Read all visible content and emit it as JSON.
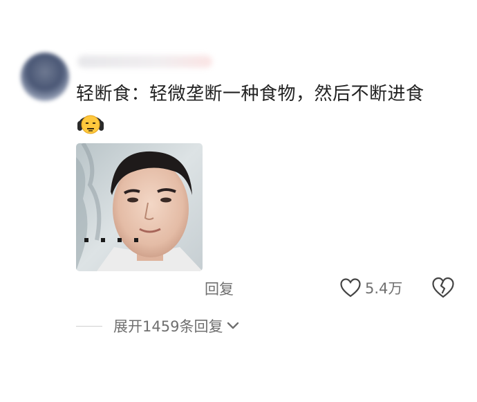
{
  "comment": {
    "username": "",
    "text": "轻断食：轻微垄断一种食物，然后不断进食",
    "emoji": "headphones-face-emoji",
    "image": "portrait-photo"
  },
  "actions": {
    "reply_label": "回复",
    "like_count": "5.4万",
    "like_icon": "heart-outline-icon",
    "dislike_icon": "broken-heart-icon"
  },
  "replies": {
    "expand_label": "展开1459条回复",
    "expand_icon": "chevron-down-icon"
  }
}
